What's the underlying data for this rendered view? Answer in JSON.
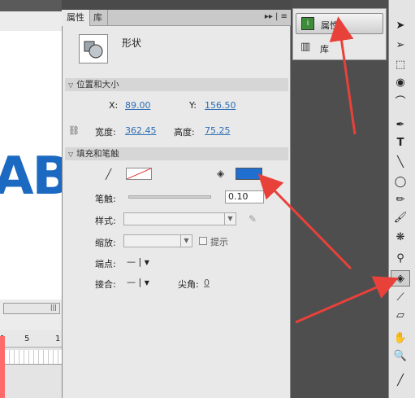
{
  "stage": {
    "ruler_frame": "1",
    "ruler_frame_5": "5",
    "ruler_frame_10": "1",
    "scroll_grip": "|||",
    "letters": "AB"
  },
  "panel": {
    "tab_properties": "属性",
    "tab_library": "库",
    "header_controls": "▸▸ | ≡",
    "shape_label": "形状",
    "section_position": "位置和大小",
    "x_label": "X:",
    "x_value": "89.00",
    "y_label": "Y:",
    "y_value": "156.50",
    "width_label": "宽度:",
    "width_value": "362.45",
    "height_label": "高度:",
    "height_value": "75.25",
    "section_fill": "填充和笔触",
    "stroke_label": "笔触:",
    "stroke_value": "0.10",
    "style_label": "样式:",
    "scale_label": "缩放:",
    "hint_label": "提示",
    "cap_label": "端点:",
    "cap_value": "—",
    "join_label": "接合:",
    "join_value": "—",
    "miter_label": "尖角:",
    "miter_value": "0",
    "fill_color": "#1e6fd0"
  },
  "right_dock": {
    "properties_label": "属性",
    "library_label": "库"
  },
  "colors": {
    "accent_red": "#e8413a",
    "link_blue": "#2f6fb3"
  }
}
